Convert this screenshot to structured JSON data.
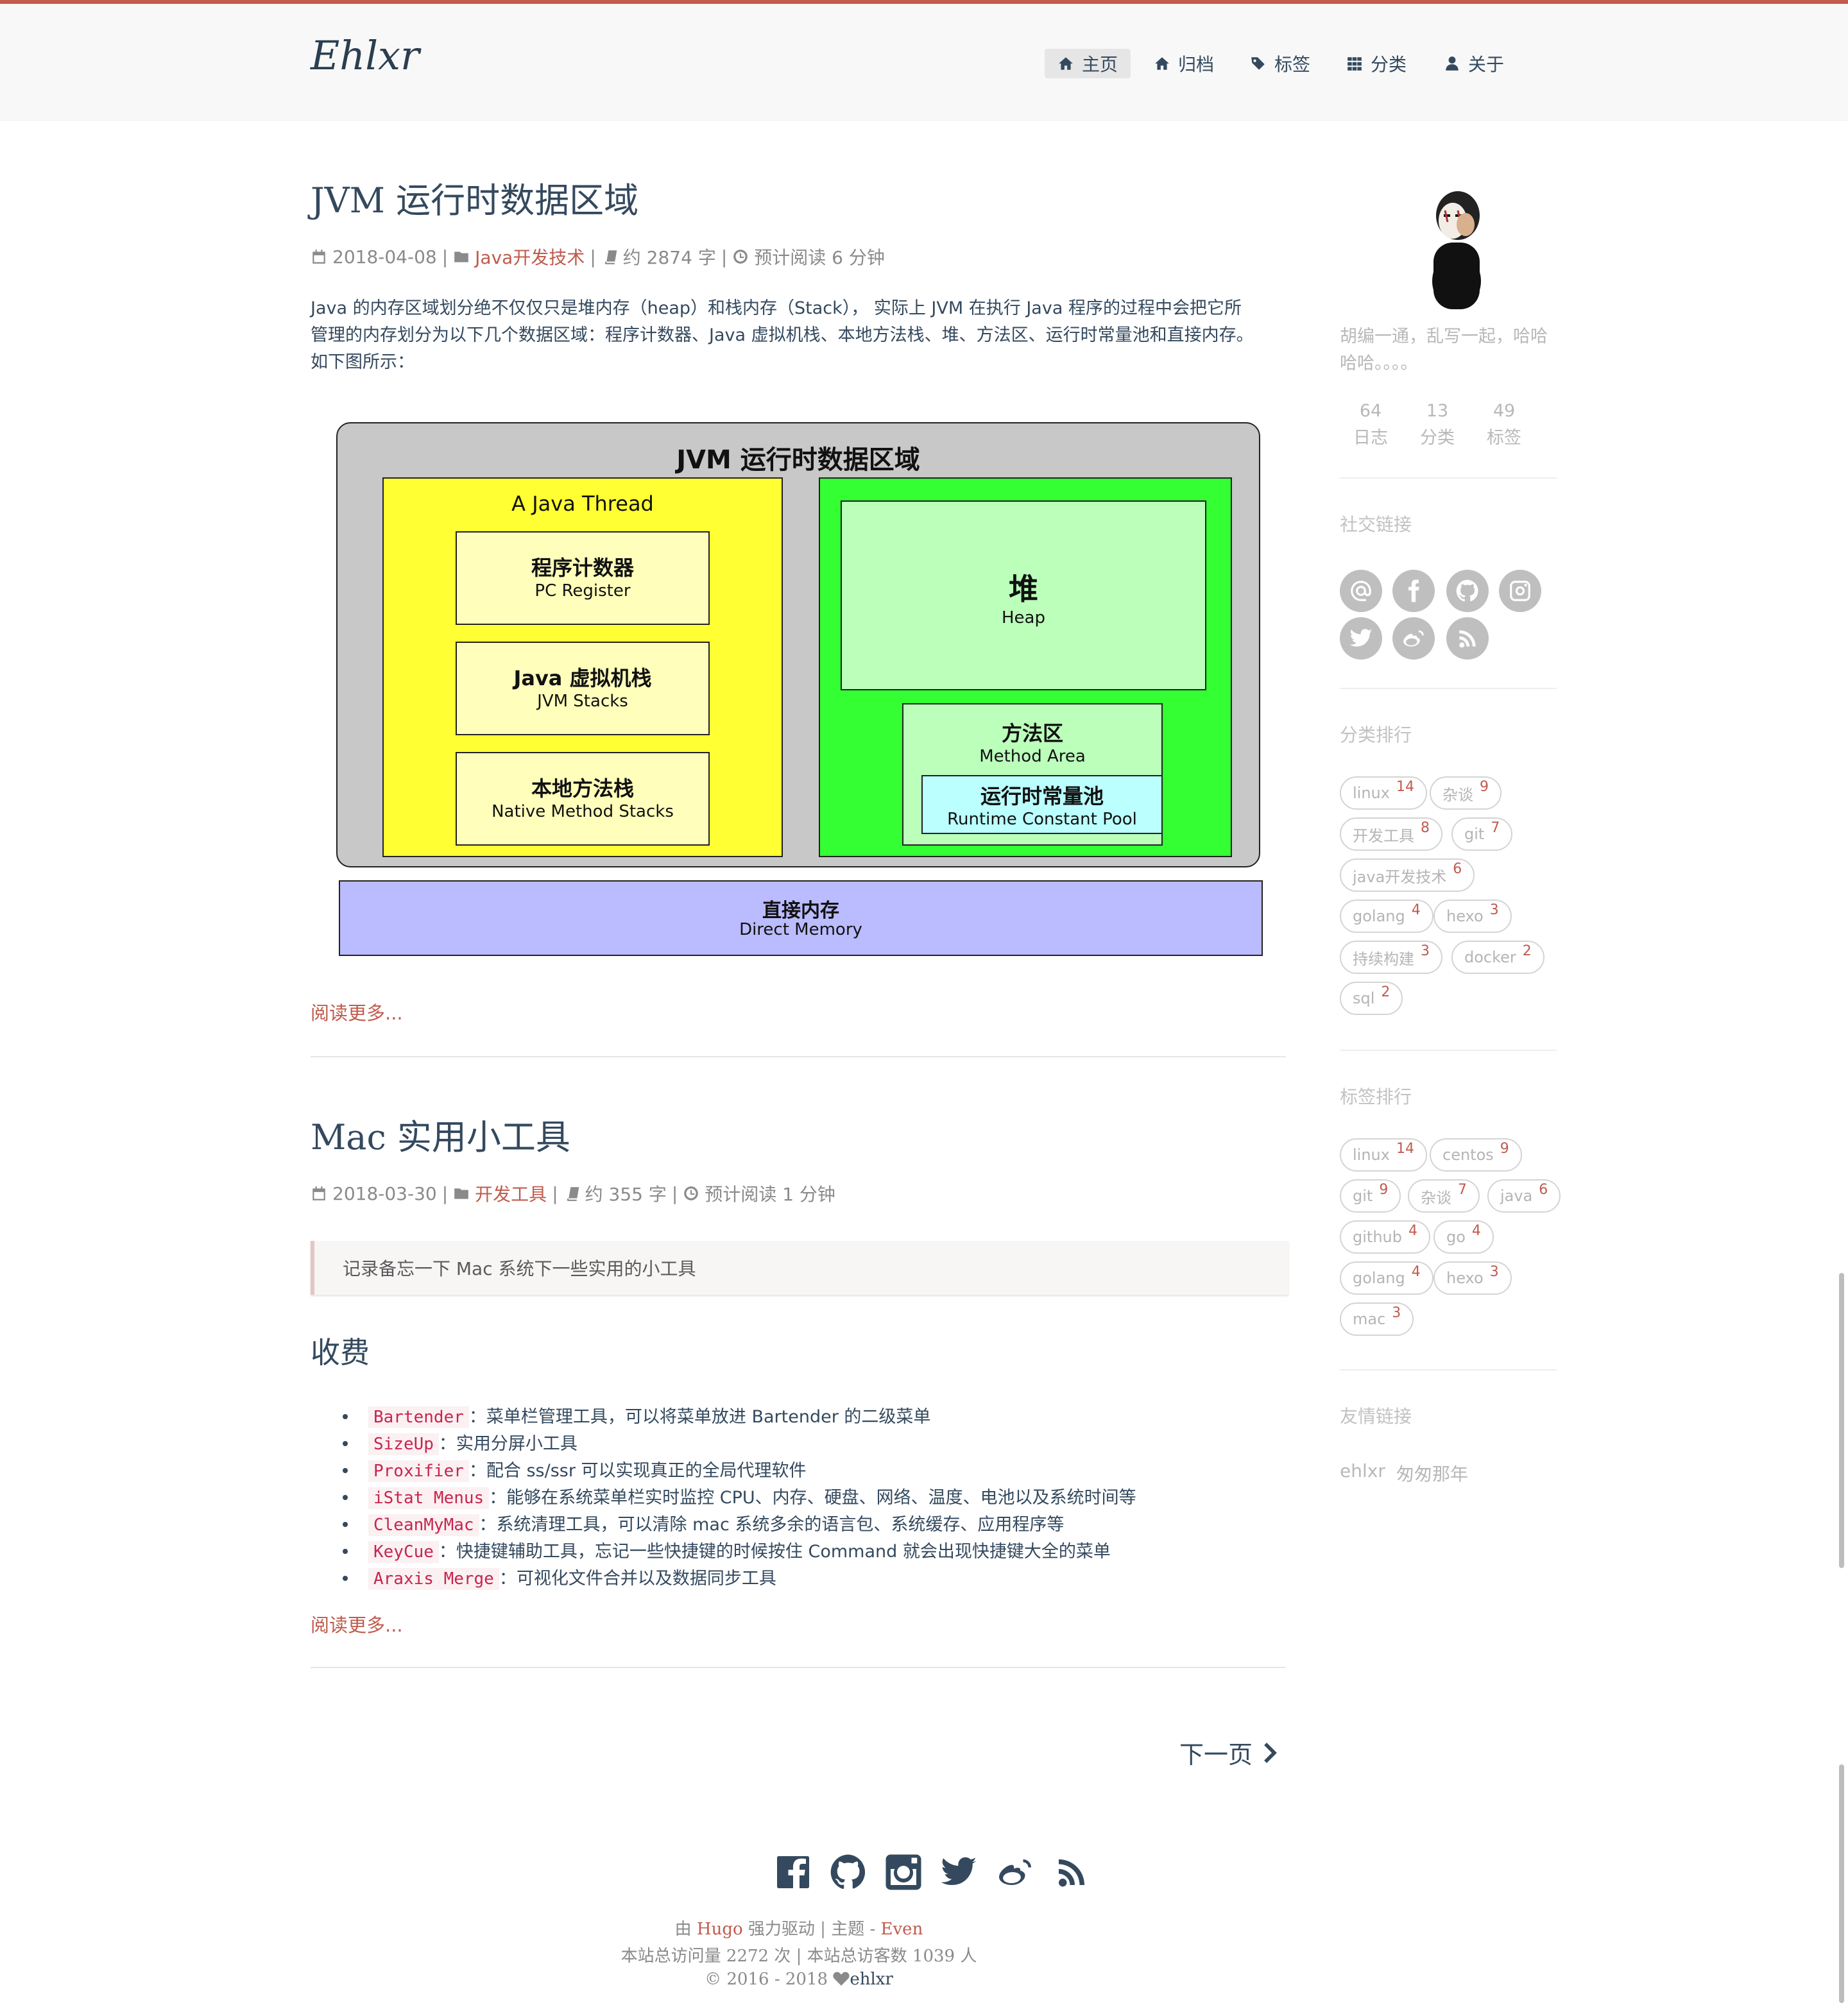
{
  "site": {
    "logo": "Ehlxr"
  },
  "nav": [
    {
      "label": "主页",
      "icon": "home-icon"
    },
    {
      "label": "归档",
      "icon": "home-icon"
    },
    {
      "label": "标签",
      "icon": "tags-icon"
    },
    {
      "label": "分类",
      "icon": "th-icon"
    },
    {
      "label": "关于",
      "icon": "user-icon"
    }
  ],
  "posts": [
    {
      "title": "JVM 运行时数据区域",
      "date": "2018-04-08",
      "category": "Java开发技术",
      "words": "约 2874 字",
      "read_time": "预计阅读 6 分钟",
      "summary_1": "Java 的内存区域划分绝不仅仅只是堆内存（heap）和栈内存（Stack），  实际上 JVM 在执行 Java 程序的过程中会把它所",
      "summary_2": "管理的内存划分为以下几个数据区域：程序计数器、Java 虚拟机栈、本地方法栈、堆、方法区、运行时常量池和直接内存。",
      "summary_3": "如下图所示：",
      "read_more": "阅读更多..."
    },
    {
      "title": "Mac 实用小工具",
      "date": "2018-03-30",
      "category": "开发工具",
      "words": "约 355 字",
      "read_time": "预计阅读 1 分钟",
      "quote": "记录备忘一下 Mac 系统下一些实用的小工具",
      "section": "收费",
      "tools": [
        {
          "name": "Bartender",
          "desc": "：菜单栏管理工具，可以将菜单放进 Bartender 的二级菜单"
        },
        {
          "name": "SizeUp",
          "desc": "：实用分屏小工具"
        },
        {
          "name": "Proxifier",
          "desc": "：配合 ss/ssr 可以实现真正的全局代理软件"
        },
        {
          "name": "iStat Menus",
          "desc": "：能够在系统菜单栏实时监控 CPU、内存、硬盘、网络、温度、电池以及系统时间等"
        },
        {
          "name": "CleanMyMac",
          "desc": "：系统清理工具，可以清除 mac 系统多余的语言包、系统缓存、应用程序等"
        },
        {
          "name": "KeyCue",
          "desc": "：快捷键辅助工具，忘记一些快捷键的时候按住 Command 就会出现快捷键大全的菜单"
        },
        {
          "name": "Araxis Merge",
          "desc": "：可视化文件合并以及数据同步工具"
        }
      ],
      "read_more": "阅读更多..."
    }
  ],
  "diagram": {
    "title": "JVM 运行时数据区域",
    "thread_label": "A Java Thread",
    "pc_cn": "程序计数器",
    "pc_en": "PC Register",
    "vm_cn": "Java 虚拟机栈",
    "vm_en": "JVM Stacks",
    "native_cn": "本地方法栈",
    "native_en": "Native Method Stacks",
    "heap_cn": "堆",
    "heap_en": "Heap",
    "method_cn": "方法区",
    "method_en": "Method Area",
    "pool_cn": "运行时常量池",
    "pool_en": "Runtime Constant Pool",
    "direct_cn": "直接内存",
    "direct_en": "Direct Memory",
    "colors": {
      "outer": "#c8c8c8",
      "thread": "#ffff33",
      "thread_inner": "#ffffbb",
      "shared": "#33ff33",
      "shared_inner": "#bbffbb",
      "pool": "#bbffff",
      "direct": "#bbbbff"
    }
  },
  "pagination": {
    "next": "下一页"
  },
  "sidebar": {
    "bio_1": "胡编一通，乱写一起，哈哈",
    "bio_2": "哈哈。。。。",
    "stats": [
      {
        "value": "64",
        "label": "日志"
      },
      {
        "value": "13",
        "label": "分类"
      },
      {
        "value": "49",
        "label": "标签"
      }
    ],
    "social_heading": "社交链接",
    "social_icons": [
      "email-icon",
      "facebook-icon",
      "github-icon",
      "instagram-icon",
      "twitter-icon",
      "weibo-icon",
      "rss-icon"
    ],
    "categories_heading": "分类排行",
    "categories": [
      {
        "name": "linux",
        "count": "14"
      },
      {
        "name": "杂谈",
        "count": "9"
      },
      {
        "name": "开发工具",
        "count": "8"
      },
      {
        "name": "git",
        "count": "7"
      },
      {
        "name": "java开发技术",
        "count": "6"
      },
      {
        "name": "golang",
        "count": "4"
      },
      {
        "name": "hexo",
        "count": "3"
      },
      {
        "name": "持续构建",
        "count": "3"
      },
      {
        "name": "docker",
        "count": "2"
      },
      {
        "name": "sql",
        "count": "2"
      }
    ],
    "tags_heading": "标签排行",
    "tags": [
      {
        "name": "linux",
        "count": "14"
      },
      {
        "name": "centos",
        "count": "9"
      },
      {
        "name": "git",
        "count": "9"
      },
      {
        "name": "杂谈",
        "count": "7"
      },
      {
        "name": "java",
        "count": "6"
      },
      {
        "name": "github",
        "count": "4"
      },
      {
        "name": "go",
        "count": "4"
      },
      {
        "name": "golang",
        "count": "4"
      },
      {
        "name": "hexo",
        "count": "3"
      },
      {
        "name": "mac",
        "count": "3"
      }
    ],
    "friends_heading": "友情链接",
    "friends": [
      "ehlxr",
      "匆匆那年"
    ]
  },
  "footer": {
    "icons": [
      "facebook-icon",
      "github-icon",
      "instagram-icon",
      "twitter-icon",
      "weibo-icon",
      "rss-icon"
    ],
    "powered_prefix": "由 ",
    "powered_hugo": "Hugo",
    "powered_mid": " 强力驱动 | 主题 - ",
    "powered_theme": "Even",
    "visits": "本站总访问量 2272 次 | 本站总访客数 1039 人",
    "copyright_prefix": "© 2016 - 2018 ",
    "copyright_author": "ehlxr"
  }
}
